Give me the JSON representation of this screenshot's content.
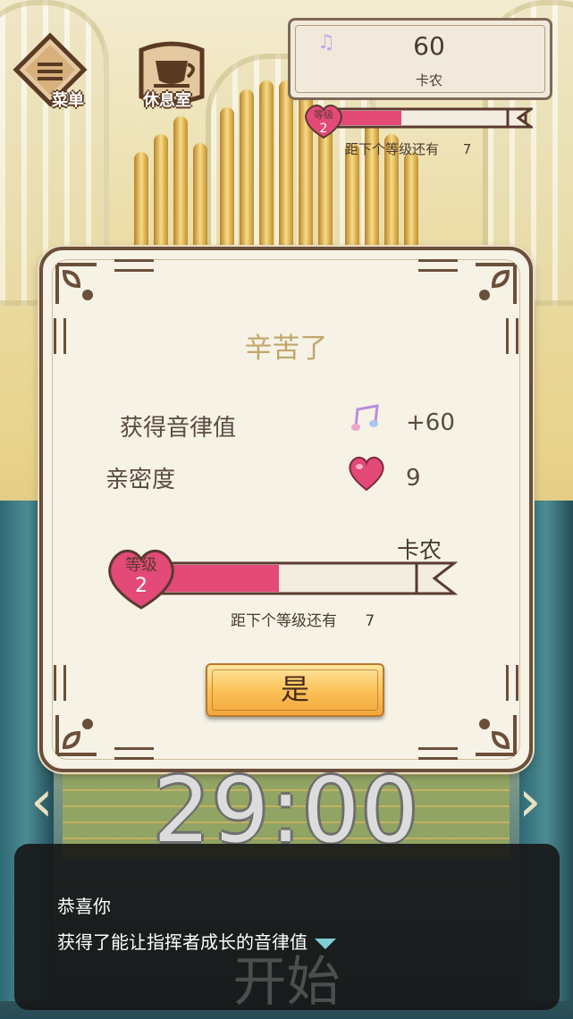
{
  "hud": {
    "menu_label": "菜单",
    "rest_label": "休息室",
    "melody_value": "60",
    "melody_character": "卡农",
    "level_label": "等级",
    "level": "2",
    "level_progress": 0.4,
    "next_level_text": "距下个等级还有",
    "next_level_value": "7"
  },
  "dialog": {
    "title": "辛苦了",
    "rows": [
      {
        "label": "获得音律值",
        "icon": "music-note-icon",
        "value": "+60"
      },
      {
        "label": "亲密度",
        "icon": "heart-icon",
        "value": "9"
      }
    ],
    "character": "卡农",
    "level_label": "等级",
    "level": "2",
    "level_progress": 0.45,
    "next_level_text": "距下个等级还有",
    "next_level_value": "7",
    "confirm_label": "是"
  },
  "timer": "29:00",
  "start_label": "开始",
  "message": {
    "speaker": "恭喜你",
    "text": "获得了能让指挥者成长的音律值"
  },
  "colors": {
    "accent_pink": "#e34a78",
    "button_gold": "#fbc35a",
    "frame_brown": "#6b4f3a"
  }
}
